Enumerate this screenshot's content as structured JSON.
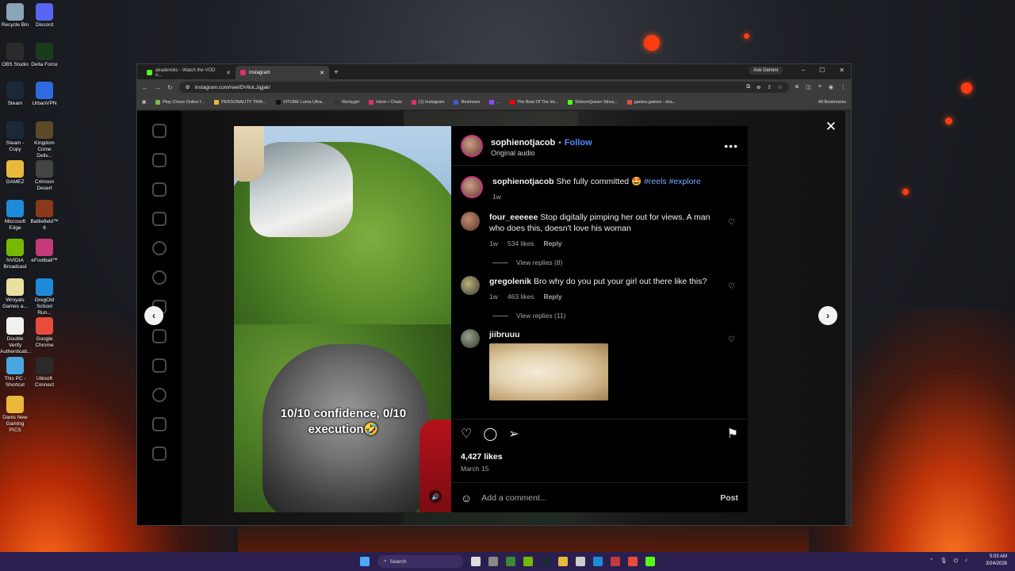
{
  "desktop": {
    "icons": [
      {
        "label": "Recycle Bin",
        "icon": "recycle-bin-icon",
        "color": "#8aa4b8"
      },
      {
        "label": "Discord",
        "icon": "discord-icon",
        "color": "#5865f2"
      },
      {
        "label": "OBS Studio",
        "icon": "obs-icon",
        "color": "#2b2b2b"
      },
      {
        "label": "Delta Force",
        "icon": "delta-force-icon",
        "color": "#1c3a1c"
      },
      {
        "label": "Steam",
        "icon": "steam-icon",
        "color": "#1b2838"
      },
      {
        "label": "UrbanVPN",
        "icon": "urbanvpn-icon",
        "color": "#2d6cdf"
      },
      {
        "label": "Steam - Copy",
        "icon": "steam-icon",
        "color": "#1b2838"
      },
      {
        "label": "Kingdom Come Deliv...",
        "icon": "kingdom-come-icon",
        "color": "#5a4a2a"
      },
      {
        "label": "GAMEZ",
        "icon": "folder-icon",
        "color": "#e8b93a"
      },
      {
        "label": "Crimson Desert",
        "icon": "crimson-desert-icon",
        "color": "#444"
      },
      {
        "label": "Microsoft Edge",
        "icon": "edge-icon",
        "color": "#1f8ad8"
      },
      {
        "label": "Battlefield™ 6",
        "icon": "battlefield-icon",
        "color": "#8a3a1a"
      },
      {
        "label": "NVIDIA Broadcast",
        "icon": "nvidia-icon",
        "color": "#76b900"
      },
      {
        "label": "eFootball™",
        "icon": "efootball-icon",
        "color": "#c43a7a"
      },
      {
        "label": "Wroyals Games a...",
        "icon": "file-icon",
        "color": "#e8e0a0"
      },
      {
        "label": "GregOld School Run...",
        "icon": "edge-icon",
        "color": "#1f8ad8"
      },
      {
        "label": "Double Verify Authenticati...",
        "icon": "file-icon",
        "color": "#f0f0f0"
      },
      {
        "label": "Google Chrome",
        "icon": "chrome-icon",
        "color": "#e84c3d"
      },
      {
        "label": "This PC - Shortcut",
        "icon": "pc-icon",
        "color": "#4aa8e0"
      },
      {
        "label": "Ubisoft Connect",
        "icon": "ubisoft-icon",
        "color": "#2a2a2a"
      },
      {
        "label": "Danis New Gaming PICS",
        "icon": "folder-icon",
        "color": "#e8b93a"
      }
    ]
  },
  "browser": {
    "tabs": [
      {
        "label": "akademiks - Watch the VOD o...",
        "active": false,
        "color": "#53fc18"
      },
      {
        "label": "Instagram",
        "active": true,
        "color": "#e1306c"
      }
    ],
    "new_tab": "+",
    "ask_gemini": "Ask Gemini",
    "window_controls": [
      "–",
      "☐",
      "✕"
    ],
    "url": "instagram.com/reel/DV6oLJqjjak/",
    "bookmarks": [
      {
        "label": "Play Chess Online f...",
        "color": "#81b64c"
      },
      {
        "label": "PERSONALITY TRAI...",
        "color": "#e8b93a"
      },
      {
        "label": "VITURE Luma Ultra...",
        "color": "#111"
      },
      {
        "label": "Rentygirl",
        "color": "#333"
      },
      {
        "label": "Inbox • Chats",
        "color": "#e1306c"
      },
      {
        "label": "(1) Instagram",
        "color": "#e1306c"
      },
      {
        "label": "Restream",
        "color": "#3b5bdb"
      },
      {
        "label": "...",
        "color": "#9146ff"
      },
      {
        "label": "The Best Of The Int...",
        "color": "#ff0000"
      },
      {
        "label": "DeleonQueen Strea...",
        "color": "#53fc18"
      },
      {
        "label": "games.games - sha...",
        "color": "#e84c3d"
      }
    ],
    "all_bookmarks": "All Bookmarks"
  },
  "post": {
    "username": "sophienotjacob",
    "follow": "Follow",
    "audio": "Original audio",
    "caption_user": "sophienotjacob",
    "caption_text": "She fully committed 🤩",
    "caption_tags": "#reels #explore",
    "caption_time": "1w",
    "video_caption": "10/10 confidence, 0/10 execution🤣",
    "comments": [
      {
        "user": "four_eeeeee",
        "text": "Stop digitally pimping her out for views. A man who does this, doesn't love his woman",
        "time": "1w",
        "likes": "534 likes",
        "reply": "Reply",
        "view_replies": "View replies (8)"
      },
      {
        "user": "gregolenik",
        "text": "Bro why do you put your girl out there like this?",
        "time": "1w",
        "likes": "463 likes",
        "reply": "Reply",
        "view_replies": "View replies (11)"
      },
      {
        "user": "jiibruuu",
        "text": ""
      }
    ],
    "like_count": "4,427 likes",
    "date": "March 15",
    "add_comment_placeholder": "Add a comment...",
    "post_button": "Post"
  },
  "taskbar": {
    "search": "Search",
    "time": "5:03 AM",
    "date": "3/24/2026"
  }
}
